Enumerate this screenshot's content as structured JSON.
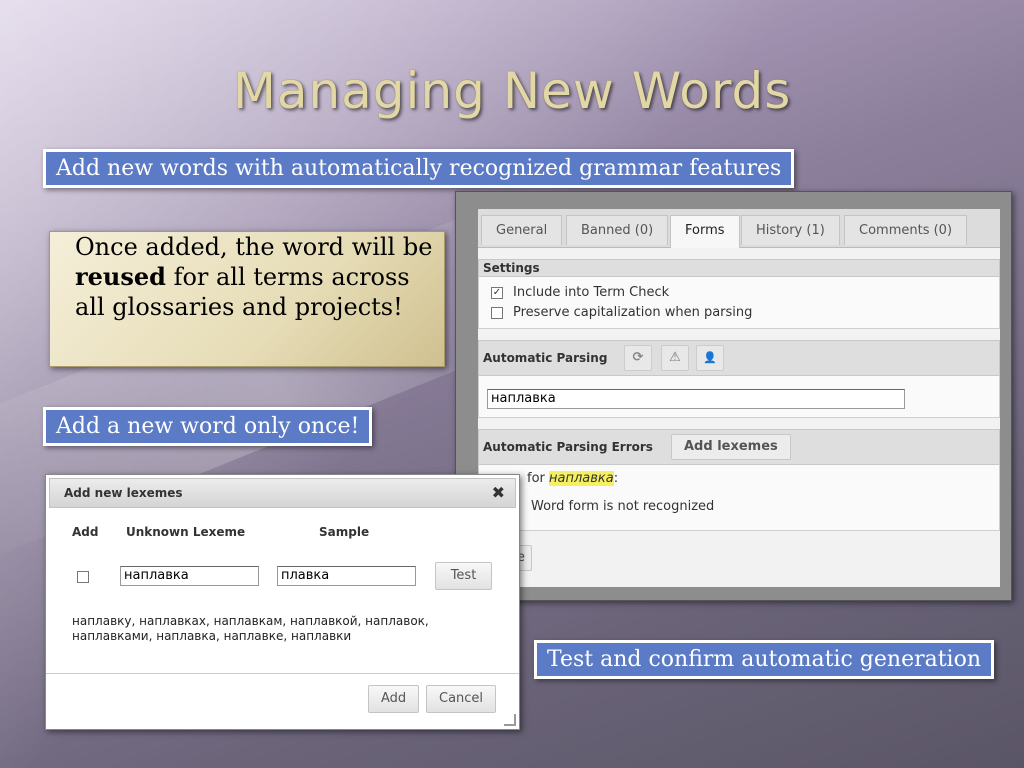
{
  "slide": {
    "title": "Managing New Words",
    "caption_top": "Add new words with automatically recognized grammar features",
    "caption_once": "Add a new word only once!",
    "caption_test": "Test and confirm automatic generation",
    "note": {
      "part1": "Once added, the word will be ",
      "bold": "reused",
      "part2": " for all terms across all glossaries and projects!"
    }
  },
  "panel": {
    "tabs": [
      {
        "label": "General",
        "active": false
      },
      {
        "label": "Banned (0)",
        "active": false
      },
      {
        "label": "Forms",
        "active": true
      },
      {
        "label": "History (1)",
        "active": false
      },
      {
        "label": "Comments (0)",
        "active": false
      }
    ],
    "settings": {
      "heading": "Settings",
      "include_label": "Include into Term Check",
      "include_checked": true,
      "preserve_label": "Preserve capitalization when parsing",
      "preserve_checked": false
    },
    "parsing": {
      "heading": "Automatic  Parsing",
      "refresh_icon": "⟳",
      "warning_icon": "⚠",
      "user_icon": "👤",
      "input_value": "наплавка"
    },
    "errors": {
      "heading": "Automatic Parsing Errors",
      "add_button": "Add lexemes",
      "for_prefix": "for ",
      "word": "наплавка",
      "for_suffix": ":",
      "message": "Word form is not recognized",
      "partial_button": "e"
    }
  },
  "dialog": {
    "title": "Add new lexemes",
    "close": "✖",
    "col_add": "Add",
    "col_unknown": "Unknown Lexeme",
    "col_sample": "Sample",
    "lexeme_value": "наплавка",
    "sample_value": "плавка",
    "test_button": "Test",
    "forms_line1": "наплавку, наплавках, наплавкам, наплавкой, наплавок,",
    "forms_line2": "наплавками, наплавка, наплавке, наплавки",
    "add_button": "Add",
    "cancel_button": "Cancel"
  }
}
